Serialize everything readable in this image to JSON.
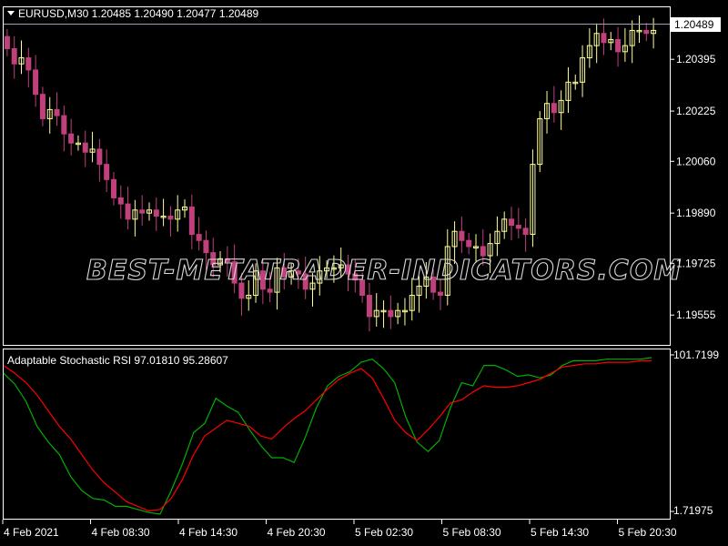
{
  "price_panel": {
    "title": "EURUSD,M30  1.20485 1.20490 1.20477 1.20489",
    "current_price_label": "1.20489"
  },
  "indicator_panel": {
    "title": "Adaptable Stochastic RSI 97.01810 95.28607"
  },
  "watermark": "BEST-METATRADER-INDICATORS.COM",
  "colors": {
    "background": "#000000",
    "bull_candle": "#ffff99",
    "bear_candle": "#c0407c",
    "axis": "#ffffff",
    "price_line": "#a0a0b8",
    "stoch_main": "#00b000",
    "stoch_signal": "#ff0000"
  },
  "chart_data": [
    {
      "type": "candlestick",
      "symbol": "EURUSD",
      "timeframe": "M30",
      "ylim": [
        1.1946,
        1.2056
      ],
      "y_ticks": [
        "1.20395",
        "1.20225",
        "1.20060",
        "1.19890",
        "1.19725",
        "1.19555"
      ],
      "y_tick_values": [
        1.20395,
        1.20225,
        1.2006,
        1.1989,
        1.19725,
        1.19555
      ],
      "x_ticks": [
        "4 Feb 2021",
        "4 Feb 08:30",
        "4 Feb 14:30",
        "4 Feb 20:30",
        "5 Feb 02:30",
        "5 Feb 08:30",
        "5 Feb 14:30",
        "5 Feb 20:30"
      ],
      "close_values": [
        1.2043,
        1.2038,
        1.204,
        1.2036,
        1.2028,
        1.202,
        1.2023,
        1.2021,
        1.2015,
        1.2012,
        1.2012,
        1.2009,
        1.201,
        1.2005,
        1.2,
        1.1994,
        1.1992,
        1.1987,
        1.199,
        1.1989,
        1.199,
        1.1988,
        1.1988,
        1.1987,
        1.199,
        1.1991,
        1.1982,
        1.198,
        1.1976,
        1.1972,
        1.1974,
        1.1973,
        1.1966,
        1.1961,
        1.1962,
        1.197,
        1.1964,
        1.1963,
        1.1971,
        1.1968,
        1.197,
        1.1969,
        1.1964,
        1.1966,
        1.197,
        1.1971,
        1.1971,
        1.1972,
        1.1969,
        1.1967,
        1.1962,
        1.1955,
        1.1957,
        1.1957,
        1.1955,
        1.1957,
        1.1957,
        1.1962,
        1.1965,
        1.1968,
        1.1963,
        1.1962,
        1.1978,
        1.1983,
        1.198,
        1.1978,
        1.1978,
        1.1975,
        1.1979,
        1.1983,
        1.1987,
        1.1985,
        1.1984,
        1.1982,
        1.2005,
        1.202,
        1.2025,
        1.2022,
        1.2026,
        1.2032,
        1.2032,
        1.204,
        1.2044,
        1.2048,
        1.2045,
        1.2046,
        1.2042,
        1.2044,
        1.2049,
        1.2049,
        1.2048,
        1.2049
      ],
      "green_line_label": "",
      "signal_label": ""
    },
    {
      "type": "line",
      "name_in_title": "Adaptable Stochastic RSI",
      "ylim": [
        1.71975,
        101.7199
      ],
      "y_ticks": [
        "101.7199",
        "1.71975"
      ],
      "series": [
        {
          "color": "green",
          "values": [
            90,
            83,
            72,
            56,
            46,
            38,
            24,
            15,
            10,
            9,
            5,
            5,
            3,
            1,
            0,
            15,
            32,
            52,
            58,
            74,
            69,
            65,
            54,
            44,
            36,
            36,
            33,
            49,
            68,
            82,
            88,
            91,
            97,
            99,
            93,
            84,
            62,
            46,
            40,
            47,
            68,
            84,
            82,
            95,
            95,
            92,
            88,
            89,
            87,
            89,
            95,
            98,
            98,
            98,
            99,
            99,
            99,
            99,
            100
          ]
        },
        {
          "color": "red",
          "values": [
            95,
            90,
            84,
            76,
            66,
            56,
            48,
            38,
            28,
            20,
            14,
            8,
            5,
            2,
            3,
            10,
            22,
            38,
            50,
            55,
            60,
            58,
            56,
            50,
            48,
            55,
            61,
            66,
            73,
            80,
            86,
            90,
            93,
            87,
            74,
            60,
            52,
            47,
            54,
            62,
            71,
            73,
            78,
            82,
            81,
            81,
            82,
            84,
            86,
            90,
            94,
            95,
            96,
            96,
            97,
            97,
            97,
            98,
            98
          ]
        }
      ]
    }
  ]
}
